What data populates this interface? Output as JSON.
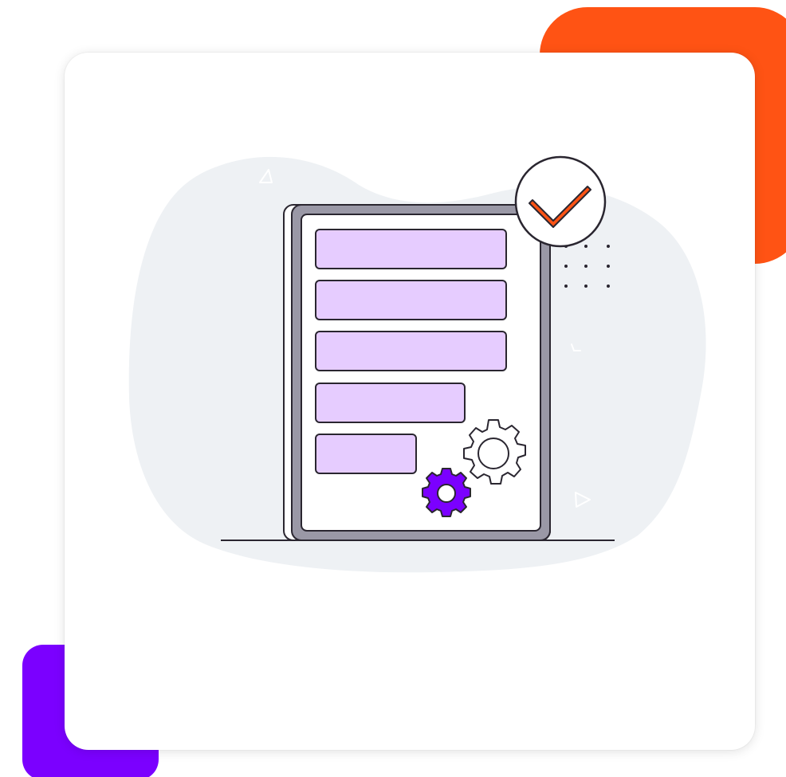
{
  "colors": {
    "accent_orange": "#FF5314",
    "accent_purple": "#7B00FF",
    "card_background": "#FFFFFF",
    "blob_background": "#EEF1F4",
    "document_bar_fill": "#E6CCFF",
    "gear_purple": "#7B00FF",
    "checkmark_orange": "#FF5314",
    "outline": "#2A2630",
    "frame_gray": "#9A98A6"
  },
  "illustration": {
    "document_bars": 5,
    "icons": [
      "document-icon",
      "check-circle-icon",
      "gear-icon",
      "gear-icon"
    ]
  }
}
